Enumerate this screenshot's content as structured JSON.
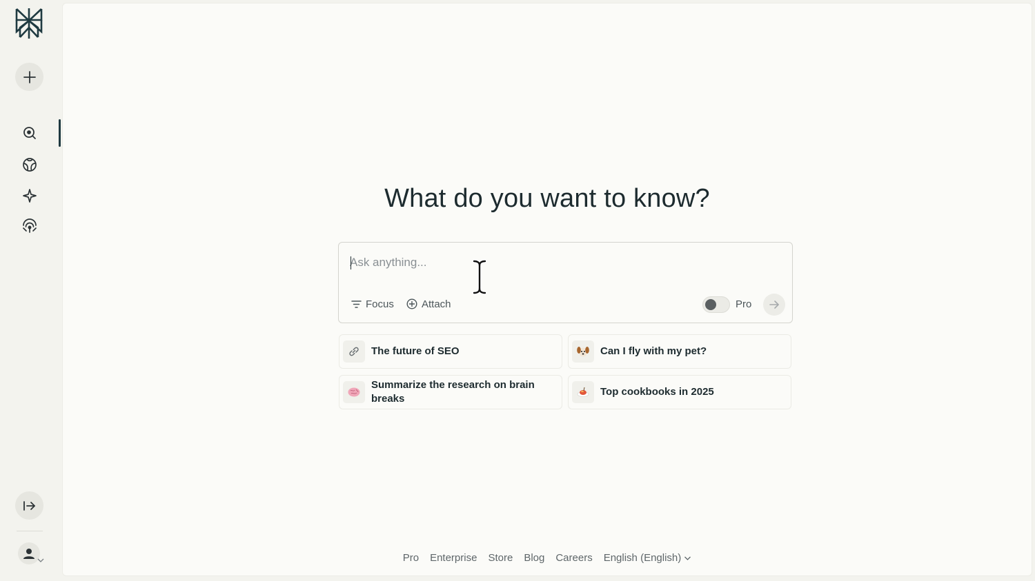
{
  "headline": "What do you want to know?",
  "search": {
    "placeholder": "Ask anything...",
    "focus_label": "Focus",
    "attach_label": "Attach",
    "pro_label": "Pro"
  },
  "suggestions": [
    {
      "label": "The future of SEO",
      "icon": "link-icon"
    },
    {
      "label": "Can I fly with my pet?",
      "icon": "dog-icon"
    },
    {
      "label": "Summarize the research on brain breaks",
      "icon": "brain-icon"
    },
    {
      "label": "Top cookbooks in 2025",
      "icon": "food-icon"
    }
  ],
  "footer": {
    "links": [
      "Pro",
      "Enterprise",
      "Store",
      "Blog",
      "Careers"
    ],
    "language": "English (English)"
  },
  "sidebar": {
    "items": [
      "search-icon",
      "discover-globe-icon",
      "spaces-sparkle-icon",
      "library-signal-icon"
    ]
  },
  "colors": {
    "brand": "#1f3a41",
    "background": "#f3f3ee",
    "panel": "#fbfbf8"
  }
}
